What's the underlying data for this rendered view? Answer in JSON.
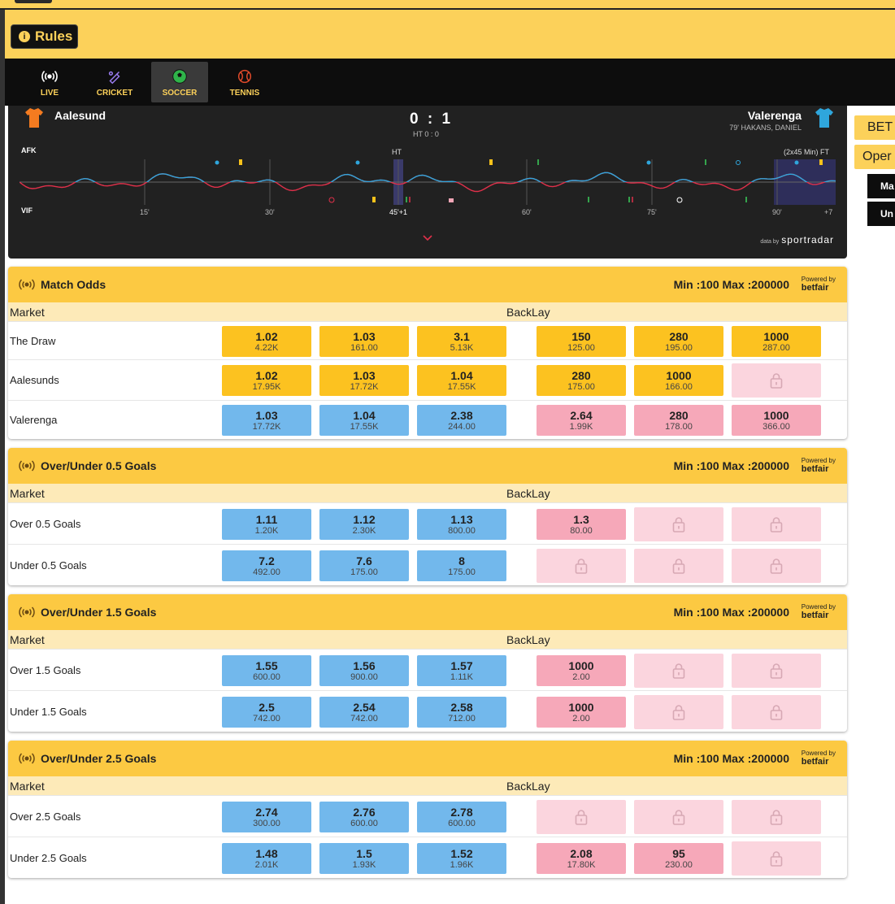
{
  "header": {
    "rules_label": "Rules"
  },
  "nav": [
    {
      "label": "LIVE",
      "icon": "live-icon"
    },
    {
      "label": "CRICKET",
      "icon": "cricket-icon"
    },
    {
      "label": "SOCCER",
      "icon": "soccer-icon",
      "active": true
    },
    {
      "label": "TENNIS",
      "icon": "tennis-icon"
    }
  ],
  "side": {
    "bet_label": "BET",
    "open_label": "Oper",
    "dark1": "Ma",
    "dark2": "Un"
  },
  "match": {
    "home": "Aalesund",
    "away": "Valerenga",
    "score": "0 : 1",
    "ht": "HT 0 : 0",
    "scorer": "79' HAKANS, DANIEL",
    "home_short": "AFK",
    "away_short": "VIF",
    "ht_label": "HT",
    "ft_label": "(2x45 Min) FT",
    "ticks": [
      "15'",
      "30'",
      "45'+1",
      "60'",
      "75'",
      "90'",
      "+7"
    ],
    "powered": "data by",
    "brand": "sportradar",
    "home_color": "#f47b20",
    "away_color": "#2fa6dc"
  },
  "labels": {
    "market": "Market",
    "back": "Back",
    "lay": "Lay",
    "min_max": "Min :100 Max :200000",
    "powered": "Powered by",
    "betfair": "betfair"
  },
  "markets": [
    {
      "title": "Match Odds",
      "rows": [
        {
          "name": "The Draw",
          "back": [
            {
              "o": "1.02",
              "s": "4.22K",
              "c": "y"
            },
            {
              "o": "1.03",
              "s": "161.00",
              "c": "y"
            },
            {
              "o": "3.1",
              "s": "5.13K",
              "c": "y"
            }
          ],
          "lay": [
            {
              "o": "150",
              "s": "125.00",
              "c": "y"
            },
            {
              "o": "280",
              "s": "195.00",
              "c": "y"
            },
            {
              "o": "1000",
              "s": "287.00",
              "c": "y"
            }
          ]
        },
        {
          "name": "Aalesunds",
          "back": [
            {
              "o": "1.02",
              "s": "17.95K",
              "c": "y"
            },
            {
              "o": "1.03",
              "s": "17.72K",
              "c": "y"
            },
            {
              "o": "1.04",
              "s": "17.55K",
              "c": "y"
            }
          ],
          "lay": [
            {
              "o": "280",
              "s": "175.00",
              "c": "y"
            },
            {
              "o": "1000",
              "s": "166.00",
              "c": "y"
            },
            {
              "locked": true
            }
          ]
        },
        {
          "name": "Valerenga",
          "back": [
            {
              "o": "1.03",
              "s": "17.72K",
              "c": "bl"
            },
            {
              "o": "1.04",
              "s": "17.55K",
              "c": "bl"
            },
            {
              "o": "2.38",
              "s": "244.00",
              "c": "bl"
            }
          ],
          "lay": [
            {
              "o": "2.64",
              "s": "1.99K",
              "c": "pk"
            },
            {
              "o": "280",
              "s": "178.00",
              "c": "pk"
            },
            {
              "o": "1000",
              "s": "366.00",
              "c": "pk"
            }
          ]
        }
      ]
    },
    {
      "title": "Over/Under 0.5 Goals",
      "rows": [
        {
          "name": "Over 0.5 Goals",
          "back": [
            {
              "o": "1.11",
              "s": "1.20K",
              "c": "bl"
            },
            {
              "o": "1.12",
              "s": "2.30K",
              "c": "bl"
            },
            {
              "o": "1.13",
              "s": "800.00",
              "c": "bl"
            }
          ],
          "lay": [
            {
              "o": "1.3",
              "s": "80.00",
              "c": "pk"
            },
            {
              "locked": true
            },
            {
              "locked": true
            }
          ]
        },
        {
          "name": "Under 0.5 Goals",
          "back": [
            {
              "o": "7.2",
              "s": "492.00",
              "c": "bl"
            },
            {
              "o": "7.6",
              "s": "175.00",
              "c": "bl"
            },
            {
              "o": "8",
              "s": "175.00",
              "c": "bl"
            }
          ],
          "lay": [
            {
              "locked": true
            },
            {
              "locked": true
            },
            {
              "locked": true
            }
          ]
        }
      ]
    },
    {
      "title": "Over/Under 1.5 Goals",
      "rows": [
        {
          "name": "Over 1.5 Goals",
          "back": [
            {
              "o": "1.55",
              "s": "600.00",
              "c": "bl"
            },
            {
              "o": "1.56",
              "s": "900.00",
              "c": "bl"
            },
            {
              "o": "1.57",
              "s": "1.11K",
              "c": "bl"
            }
          ],
          "lay": [
            {
              "o": "1000",
              "s": "2.00",
              "c": "pk"
            },
            {
              "locked": true
            },
            {
              "locked": true
            }
          ]
        },
        {
          "name": "Under 1.5 Goals",
          "back": [
            {
              "o": "2.5",
              "s": "742.00",
              "c": "bl"
            },
            {
              "o": "2.54",
              "s": "742.00",
              "c": "bl"
            },
            {
              "o": "2.58",
              "s": "712.00",
              "c": "bl"
            }
          ],
          "lay": [
            {
              "o": "1000",
              "s": "2.00",
              "c": "pk"
            },
            {
              "locked": true
            },
            {
              "locked": true
            }
          ]
        }
      ]
    },
    {
      "title": "Over/Under 2.5 Goals",
      "rows": [
        {
          "name": "Over 2.5 Goals",
          "back": [
            {
              "o": "2.74",
              "s": "300.00",
              "c": "bl"
            },
            {
              "o": "2.76",
              "s": "600.00",
              "c": "bl"
            },
            {
              "o": "2.78",
              "s": "600.00",
              "c": "bl"
            }
          ],
          "lay": [
            {
              "locked": true
            },
            {
              "locked": true
            },
            {
              "locked": true
            }
          ]
        },
        {
          "name": "Under 2.5 Goals",
          "back": [
            {
              "o": "1.48",
              "s": "2.01K",
              "c": "bl"
            },
            {
              "o": "1.5",
              "s": "1.93K",
              "c": "bl"
            },
            {
              "o": "1.52",
              "s": "1.96K",
              "c": "bl"
            }
          ],
          "lay": [
            {
              "o": "2.08",
              "s": "17.80K",
              "c": "pk"
            },
            {
              "o": "95",
              "s": "230.00",
              "c": "pk"
            },
            {
              "locked": true
            }
          ]
        }
      ]
    }
  ]
}
